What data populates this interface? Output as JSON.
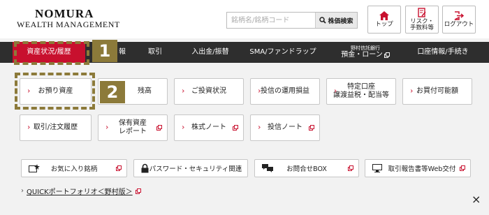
{
  "header": {
    "logo_line1": "NOMURA",
    "logo_line2": "WEALTH MANAGEMENT",
    "search_placeholder": "銘柄名/銘柄コード",
    "search_button": "株価検索",
    "top_label": "トップ",
    "risk_label_1": "リスク・",
    "risk_label_2": "手数料等",
    "logout_label": "ログアウト"
  },
  "nav": {
    "items": [
      {
        "label": "資産状況/履歴"
      },
      {
        "label": "報"
      },
      {
        "label": "取引"
      },
      {
        "label": "入出金/振替"
      },
      {
        "label": "SMA/ファンドラップ"
      },
      {
        "sub": "野村信託銀行",
        "label": "預金・ローン"
      },
      {
        "label": "口座情報/手続き"
      }
    ]
  },
  "badges": [
    "1",
    "2"
  ],
  "tiles": {
    "row1": [
      {
        "label": "お預り資産"
      },
      {
        "label": "残高"
      },
      {
        "label": "ご投資状況"
      },
      {
        "label": "投信の運用損益"
      },
      {
        "label1": "特定口座",
        "label2": "譲渡益税・配当等"
      },
      {
        "label": "お買付可能額"
      }
    ],
    "row2": [
      {
        "label": "取引/注文履歴"
      },
      {
        "label1": "保有資産",
        "label2": "レポート"
      },
      {
        "label": "株式ノート"
      },
      {
        "label": "投信ノート"
      }
    ]
  },
  "utilities": [
    {
      "label": "お気に入り銘柄"
    },
    {
      "label": "パスワード・セキュリティ関連"
    },
    {
      "label": "お問合せBOX"
    },
    {
      "label": "取引報告書等Web交付"
    }
  ],
  "footer": {
    "quick_link": "QUICKポートフォリオ＜野村版＞",
    "close": "×"
  },
  "colors": {
    "accent": "#c8102e",
    "nav_bg": "#2e2e2e",
    "highlight": "#8c7a3a"
  }
}
